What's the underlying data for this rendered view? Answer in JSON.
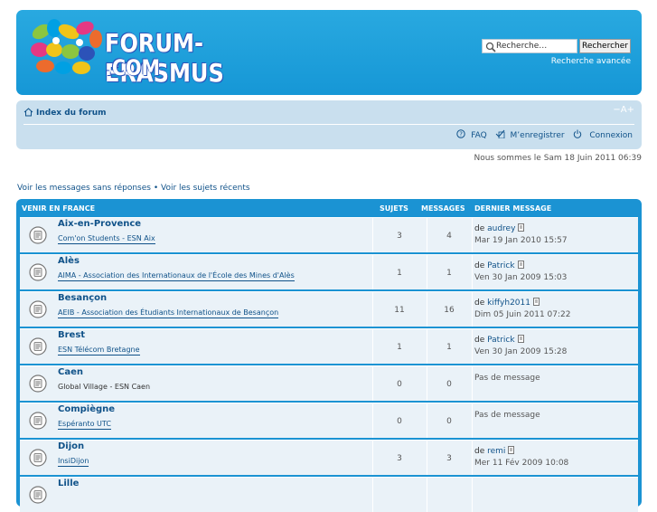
{
  "header": {
    "logo_line1": "FORUM-ERASMUS",
    "logo_line2": ".COM",
    "search_placeholder": "Recherche…",
    "search_button": "Rechercher",
    "advanced_search": "Recherche avancée"
  },
  "navbar": {
    "index_link": "Index du forum",
    "font_size": "−A+",
    "faq": "FAQ",
    "register": "M’enregistrer",
    "login": "Connexion"
  },
  "date_text": "Nous sommes le Sam 18 Juin 2011 06:39",
  "quick_links": {
    "unanswered": "Voir les messages sans réponses",
    "separator": " • ",
    "recent": "Voir les sujets récents"
  },
  "forum": {
    "category": "VENIR EN FRANCE",
    "col_topics": "SUJETS",
    "col_posts": "MESSAGES",
    "col_last": "DERNIER MESSAGE",
    "rows": [
      {
        "title": "Aix-en-Provence",
        "desc": "Com'on Students - ESN Aix",
        "topics": "3",
        "posts": "4",
        "by": "de ",
        "author": "audrey",
        "date": "Mar 19 Jan 2010 15:57"
      },
      {
        "title": "Alès",
        "desc": "AIMA - Association des Internationaux de l'École des Mines d'Alès",
        "topics": "1",
        "posts": "1",
        "by": "de ",
        "author": "Patrick",
        "date": "Ven 30 Jan 2009 15:03"
      },
      {
        "title": "Besançon",
        "desc": "AEIB - Association des Étudiants Internationaux de Besançon",
        "topics": "11",
        "posts": "16",
        "by": "de ",
        "author": "kiffyh2011",
        "date": "Dim 05 Juin 2011 07:22"
      },
      {
        "title": "Brest",
        "desc": "ESN Télécom Bretagne",
        "topics": "1",
        "posts": "1",
        "by": "de ",
        "author": "Patrick",
        "date": "Ven 30 Jan 2009 15:28"
      },
      {
        "title": "Caen",
        "desc": "Global Village - ESN Caen",
        "topics": "0",
        "posts": "0",
        "no_msg": "Pas de message"
      },
      {
        "title": "Compiègne",
        "desc": "Espéranto UTC",
        "topics": "0",
        "posts": "0",
        "no_msg": "Pas de message"
      },
      {
        "title": "Dijon",
        "desc": "InsiDijon",
        "topics": "3",
        "posts": "3",
        "by": "de ",
        "author": "remi",
        "date": "Mer 11 Fév 2009 10:08"
      },
      {
        "title": "Lille"
      }
    ]
  }
}
